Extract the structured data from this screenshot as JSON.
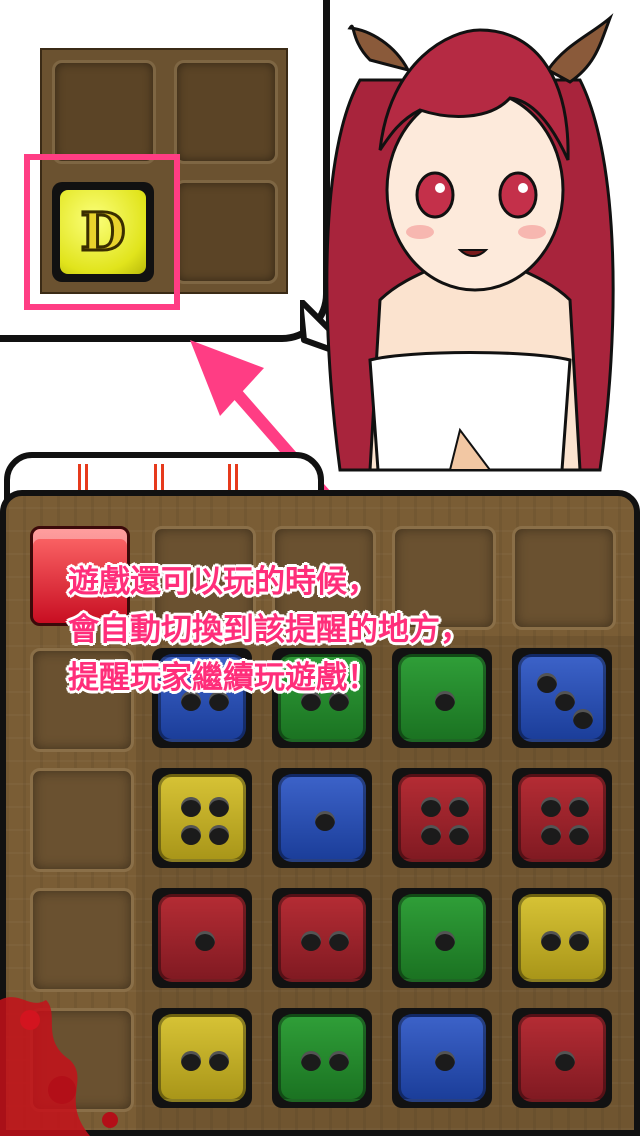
{
  "caption": {
    "line1": "遊戲還可以玩的時候，",
    "line2": "會自動切換到該提醒的地方，",
    "line3": "提醒玩家繼續玩遊戲！"
  },
  "hint_tile": {
    "letter": "D"
  },
  "colors": {
    "highlight": "#ff3d84",
    "caption_text": "#ff2e7a",
    "board_wood": "#7a5d35"
  },
  "dice_grid": [
    [
      {
        "color": "blue",
        "pips": 2
      },
      {
        "color": "green",
        "pips": 2
      },
      {
        "color": "green",
        "pips": 1
      },
      {
        "color": "blue",
        "pips": 3
      }
    ],
    [
      {
        "color": "yellow",
        "pips": 4
      },
      {
        "color": "blue",
        "pips": 1
      },
      {
        "color": "red",
        "pips": 4
      },
      {
        "color": "red",
        "pips": 4
      }
    ],
    [
      {
        "color": "red",
        "pips": 1
      },
      {
        "color": "red",
        "pips": 2
      },
      {
        "color": "green",
        "pips": 1
      },
      {
        "color": "yellow",
        "pips": 2
      }
    ],
    [
      {
        "color": "yellow",
        "pips": 2
      },
      {
        "color": "green",
        "pips": 2
      },
      {
        "color": "blue",
        "pips": 1
      },
      {
        "color": "red",
        "pips": 1
      }
    ]
  ]
}
